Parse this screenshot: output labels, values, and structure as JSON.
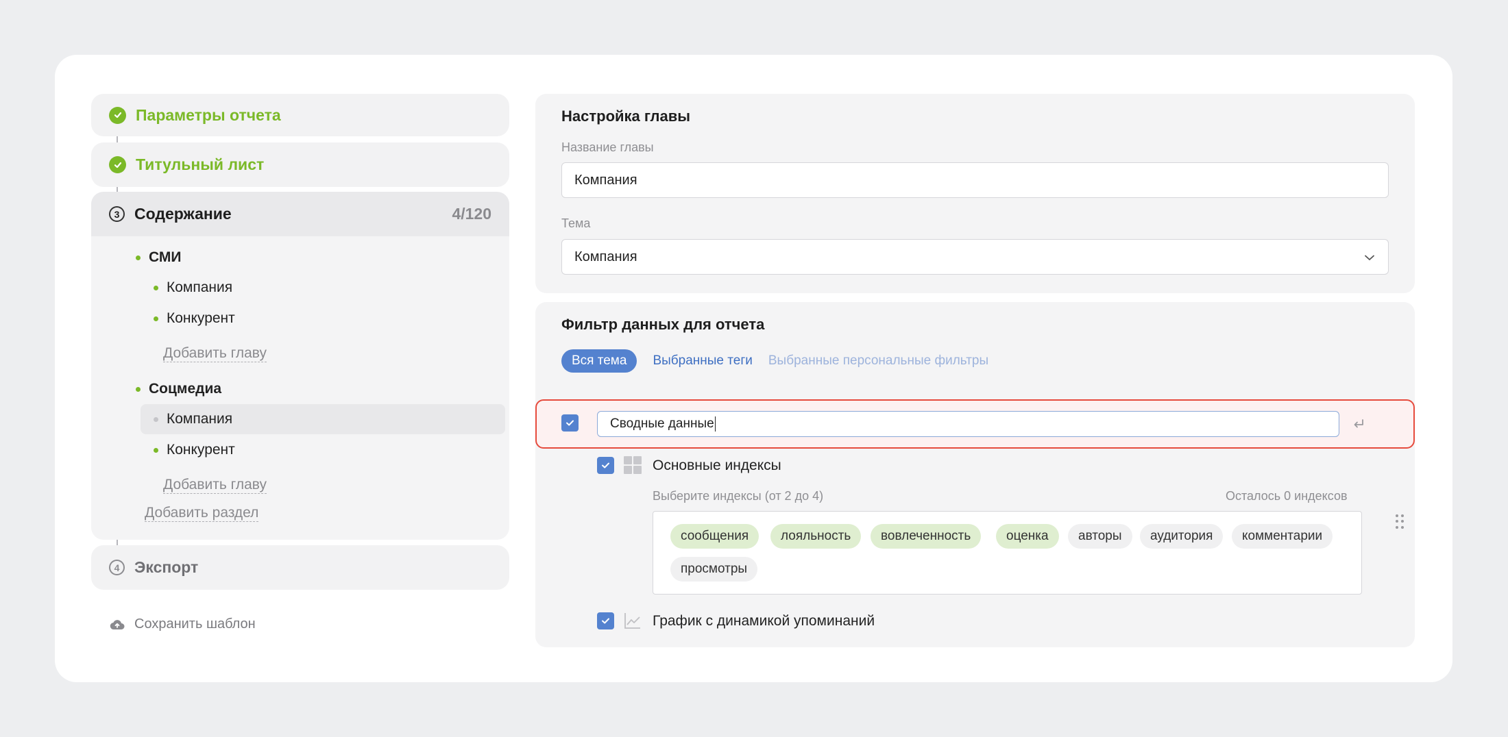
{
  "stepper": {
    "steps": [
      {
        "label": "Параметры отчета",
        "status": "done"
      },
      {
        "label": "Титульный лист",
        "status": "done"
      },
      {
        "label": "Содержание",
        "number": "3",
        "count": "4/120",
        "status": "active"
      },
      {
        "label": "Экспорт",
        "number": "4",
        "status": "pending"
      }
    ],
    "sections": [
      {
        "title": "СМИ",
        "items": [
          "Компания",
          "Конкурент"
        ],
        "add_chapter": "Добавить главу"
      },
      {
        "title": "Соцмедиа",
        "items": [
          "Компания",
          "Конкурент"
        ],
        "add_chapter": "Добавить главу"
      }
    ],
    "add_section": "Добавить раздел",
    "save_template": "Сохранить шаблон"
  },
  "chapter": {
    "title": "Настройка главы",
    "name_label": "Название главы",
    "name_value": "Компания",
    "topic_label": "Тема",
    "topic_value": "Компания"
  },
  "filter": {
    "title": "Фильтр данных для отчета",
    "tabs": [
      "Вся тема",
      "Выбранные теги",
      "Выбранные персональные фильтры"
    ]
  },
  "block": {
    "section_value": "Сводные данные",
    "indices_label": "Основные индексы",
    "indices_hint": "Выберите индексы (от 2 до 4)",
    "indices_remaining": "Осталось 0 индексов",
    "tags": [
      {
        "label": "сообщения",
        "selected": true
      },
      {
        "label": "лояльность",
        "selected": true
      },
      {
        "label": "вовлеченность",
        "selected": true
      },
      {
        "label": "оценка",
        "selected": true
      },
      {
        "label": "авторы",
        "selected": false
      },
      {
        "label": "аудитория",
        "selected": false
      },
      {
        "label": "комментарии",
        "selected": false
      },
      {
        "label": "просмотры",
        "selected": false
      }
    ],
    "chart_label": "График с динамикой упоминаний"
  },
  "colors": {
    "success": "#7bb928",
    "accent": "#5482cf",
    "error": "#e64a3c"
  }
}
